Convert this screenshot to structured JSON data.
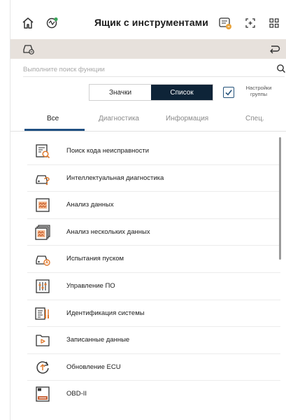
{
  "header": {
    "title": "Ящик с инструментами",
    "icons": [
      "home-icon",
      "vci-icon",
      "obd-device-icon",
      "screenshot-icon",
      "apps-grid-icon"
    ]
  },
  "vehicle_bar": {
    "icons": [
      "car-settings-icon",
      "return-icon"
    ]
  },
  "search": {
    "placeholder": "Выполните поиск функции"
  },
  "view_toggle": {
    "icons_label": "Значки",
    "list_label": "Список",
    "selected": "Список"
  },
  "group_settings": {
    "label": "Настройки группы",
    "checked": true
  },
  "tabs": [
    {
      "label": "Все",
      "active": true
    },
    {
      "label": "Диагностика",
      "active": false
    },
    {
      "label": "Информация",
      "active": false
    },
    {
      "label": "Спец.",
      "active": false
    }
  ],
  "functions": [
    {
      "label": "Поиск кода неисправности",
      "icon": "dtc-search-icon"
    },
    {
      "label": "Интеллектуальная диагностика",
      "icon": "smart-diagnosis-icon"
    },
    {
      "label": "Анализ данных",
      "icon": "data-analysis-icon"
    },
    {
      "label": "Анализ нескольких данных",
      "icon": "multi-data-analysis-icon"
    },
    {
      "label": "Испытания пуском",
      "icon": "actuation-test-icon"
    },
    {
      "label": "Управление ПО",
      "icon": "software-management-icon"
    },
    {
      "label": "Идентификация системы",
      "icon": "system-identification-icon"
    },
    {
      "label": "Записанные данные",
      "icon": "recorded-data-icon"
    },
    {
      "label": "Обновление ECU",
      "icon": "ecu-update-icon"
    },
    {
      "label": "OBD-II",
      "icon": "obd2-icon"
    }
  ],
  "colors": {
    "accent": "#0e2438",
    "tab_underline": "#1f4f82",
    "vehicle_bar": "#e7e1dc",
    "obd_badge": "#c8643a"
  }
}
